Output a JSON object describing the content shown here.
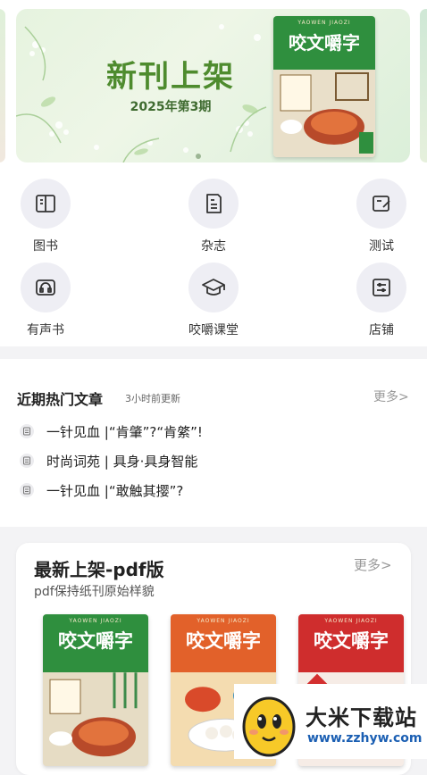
{
  "banner": {
    "title": "新刊上架",
    "subtitle": "2025年第3期",
    "cover_title": "咬文嚼字",
    "cover_pinyin": "YAOWEN JIAOZI"
  },
  "categories": [
    {
      "label": "图书",
      "icon": "book-icon"
    },
    {
      "label": "杂志",
      "icon": "magazine-icon"
    },
    {
      "label": "测试",
      "icon": "test-edit-icon"
    },
    {
      "label": "有声书",
      "icon": "headphones-icon"
    },
    {
      "label": "咬嚼课堂",
      "icon": "graduation-cap-icon"
    },
    {
      "label": "店铺",
      "icon": "store-icon"
    }
  ],
  "hot_articles": {
    "title": "近期热门文章",
    "update_note": "3小时前更新",
    "more_label": "更多>",
    "items": [
      "一针见血 |“肯肇”?“肯綮”!",
      "时尚词苑 | 具身·具身智能",
      "一针见血 |“敢触其撄”?"
    ]
  },
  "pdf_section": {
    "title": "最新上架-pdf版",
    "subtitle": "pdf保持纸刊原始样貌",
    "more_label": "更多>",
    "covers": [
      {
        "title": "咬文嚼字",
        "pinyin": "YAOWEN JIAOZI",
        "color": "#2f8f3e"
      },
      {
        "title": "咬文嚼字",
        "pinyin": "YAOWEN JIAOZI",
        "color": "#e2612a"
      },
      {
        "title": "咬文嚼字",
        "pinyin": "YAOWEN JIAOZI",
        "color": "#cf2d2d"
      }
    ]
  },
  "watermark": {
    "text": "大米下载站",
    "url": "www.zzhyw.com"
  },
  "colors": {
    "banner_title": "#4e8b2e",
    "icon_bg": "#eeeef4",
    "icon_stroke": "#333333",
    "muted": "#999999"
  }
}
